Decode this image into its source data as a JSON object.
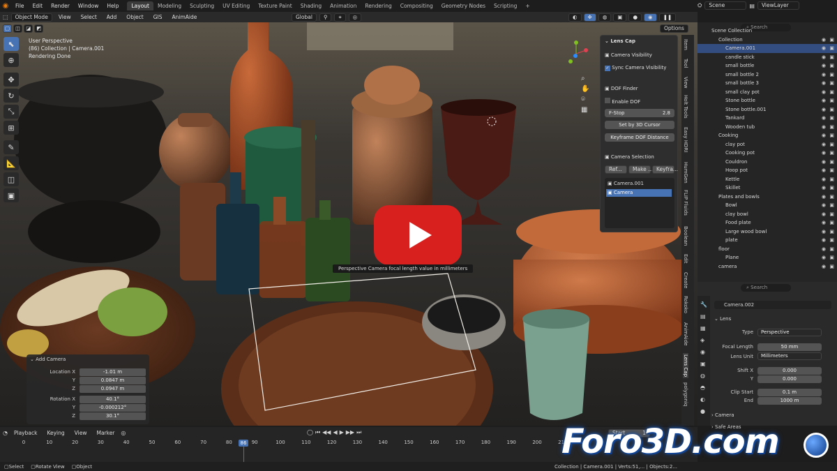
{
  "topbar": {
    "menus": [
      "File",
      "Edit",
      "Render",
      "Window",
      "Help"
    ],
    "tabs": [
      "Layout",
      "Modeling",
      "Sculpting",
      "UV Editing",
      "Texture Paint",
      "Shading",
      "Animation",
      "Rendering",
      "Compositing",
      "Geometry Nodes",
      "Scripting"
    ],
    "scene": "Scene",
    "viewlayer": "ViewLayer"
  },
  "header": {
    "mode": "Object Mode",
    "menus": [
      "View",
      "Select",
      "Add",
      "Object",
      "GIS",
      "AnimAide"
    ],
    "orientation": "Global",
    "options": "Options"
  },
  "viewport": {
    "line1": "User Perspective",
    "line2": "(86) Collection | Camera.001",
    "line3": "Rendering Done",
    "tooltip": "Perspective Camera focal length value in millimeters"
  },
  "lens_panel": {
    "title": "Lens Cap",
    "camera_visibility": "Camera Visibility",
    "sync_visibility": "Sync Camera Visibility",
    "dof_finder": "DOF Finder",
    "enable_dof": "Enable DOF",
    "fstop_label": "F-Stop",
    "fstop_value": "2.8",
    "set_3d_cursor": "Set by 3D Cursor",
    "keyframe_dof": "Keyframe DOF Distance",
    "camera_selection": "Camera Selection",
    "btn_ref": "Ref...",
    "btn_make": "Make ...",
    "btn_keyfra": "Keyfra...",
    "cameras": [
      "Camera.001",
      "Camera"
    ]
  },
  "sidetabs": [
    "Item",
    "Tool",
    "View",
    "Holt Tools",
    "Easy HDRI",
    "HumGen",
    "FLIP Fluids",
    "Boolean",
    "Edit",
    "Create",
    "Rokoko",
    "AnimAide",
    "Lens Cap",
    "polygoniq"
  ],
  "outliner": {
    "search": "Search",
    "rows": [
      {
        "label": "Scene Collection",
        "indent": 0,
        "sel": false
      },
      {
        "label": "Collection",
        "indent": 1,
        "sel": false
      },
      {
        "label": "Camera.001",
        "indent": 2,
        "sel": true
      },
      {
        "label": "candle stick",
        "indent": 2,
        "sel": false
      },
      {
        "label": "small bottle",
        "indent": 2,
        "sel": false
      },
      {
        "label": "small bottle 2",
        "indent": 2,
        "sel": false
      },
      {
        "label": "small bottle 3",
        "indent": 2,
        "sel": false
      },
      {
        "label": "small clay pot",
        "indent": 2,
        "sel": false
      },
      {
        "label": "Stone bottle",
        "indent": 2,
        "sel": false
      },
      {
        "label": "Stone bottle.001",
        "indent": 2,
        "sel": false
      },
      {
        "label": "Tankard",
        "indent": 2,
        "sel": false
      },
      {
        "label": "Wooden tub",
        "indent": 2,
        "sel": false
      },
      {
        "label": "Cooking",
        "indent": 1,
        "sel": false
      },
      {
        "label": "clay pot",
        "indent": 2,
        "sel": false
      },
      {
        "label": "Cooking pot",
        "indent": 2,
        "sel": false
      },
      {
        "label": "Couldron",
        "indent": 2,
        "sel": false
      },
      {
        "label": "Hoop pot",
        "indent": 2,
        "sel": false
      },
      {
        "label": "Kettle",
        "indent": 2,
        "sel": false
      },
      {
        "label": "Skillet",
        "indent": 2,
        "sel": false
      },
      {
        "label": "Plates and bowls",
        "indent": 1,
        "sel": false
      },
      {
        "label": "Bowl",
        "indent": 2,
        "sel": false
      },
      {
        "label": "clay bowl",
        "indent": 2,
        "sel": false
      },
      {
        "label": "Food plate",
        "indent": 2,
        "sel": false
      },
      {
        "label": "Large wood bowl",
        "indent": 2,
        "sel": false
      },
      {
        "label": "plate",
        "indent": 2,
        "sel": false
      },
      {
        "label": "floor",
        "indent": 1,
        "sel": false
      },
      {
        "label": "Plane",
        "indent": 2,
        "sel": false
      },
      {
        "label": "camera",
        "indent": 1,
        "sel": false
      }
    ]
  },
  "props": {
    "search": "Search",
    "object": "Camera.002",
    "lens": "Lens",
    "type_label": "Type",
    "type_value": "Perspective",
    "focal_label": "Focal Length",
    "focal_value": "50 mm",
    "unit_label": "Lens Unit",
    "unit_value": "Millimeters",
    "shiftx_label": "Shift X",
    "shiftx_value": "0.000",
    "y_label": "Y",
    "y_value": "0.000",
    "clipstart_label": "Clip Start",
    "clipstart_value": "0.1 m",
    "end_label": "End",
    "end_value": "1000 m",
    "camera": "Camera",
    "safe_areas": "Safe Areas",
    "bg_images": "Background Images"
  },
  "add_camera": {
    "title": "Add Camera",
    "loc_label": "Location X",
    "loc_x": "-1.01 m",
    "loc_y": "0.0847 m",
    "loc_z": "0.0947 m",
    "rot_label": "Rotation X",
    "rot_x": "40.1°",
    "rot_y": "-0.000212°",
    "rot_z": "30.1°",
    "y": "Y",
    "z": "Z"
  },
  "timeline": {
    "menus": [
      "Playback",
      "Keying",
      "View",
      "Marker"
    ],
    "current": "86",
    "start_label": "Start",
    "start_value": "1",
    "ticks": [
      "0",
      "10",
      "20",
      "30",
      "40",
      "50",
      "60",
      "70",
      "80",
      "90",
      "100",
      "110",
      "120",
      "130",
      "140",
      "150",
      "160",
      "170",
      "180",
      "190",
      "200",
      "210"
    ]
  },
  "status": {
    "select": "Select",
    "rotate": "Rotate View",
    "object": "Object",
    "right": "Collection | Camera.001 | Verts:51,... | Objects:2..."
  },
  "watermark": "Foro3D.com"
}
